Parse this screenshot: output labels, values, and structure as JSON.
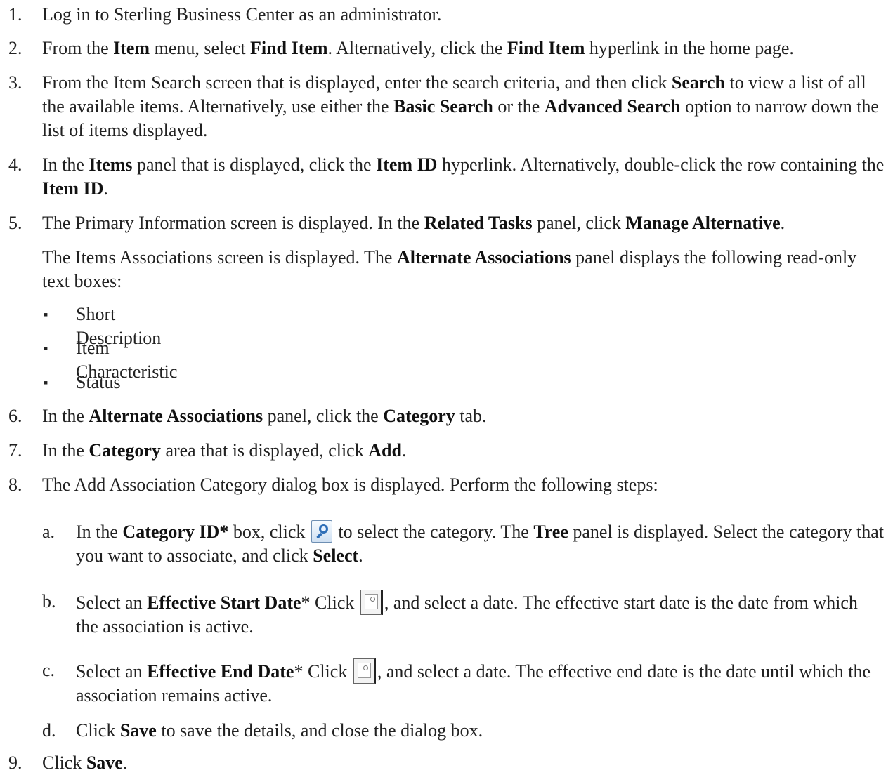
{
  "steps": [
    {
      "num": "1.",
      "html": "Log in to Sterling Business Center as an administrator."
    },
    {
      "num": "2.",
      "html": "From the <b>Item</b> menu, select <b>Find Item</b>. Alternatively, click the <b>Find Item</b> hyperlink in the home page."
    },
    {
      "num": "3.",
      "html": "From the Item Search screen that is displayed, enter the search criteria, and then click <b>Search</b> to view a list of all the available items. Alternatively, use either the <b>Basic Search</b> or the <b>Advanced Search</b> option to narrow down the list of items displayed."
    },
    {
      "num": "4.",
      "html": "In the <b>Items</b> panel that is displayed, click the <b>Item ID</b> hyperlink. Alternatively, double-click the row containing the <b>Item ID</b>."
    },
    {
      "num": "5.",
      "html": "The Primary Information screen is displayed. In the <b>Related Tasks</b> panel, click <b>Manage Alternative</b>."
    },
    {
      "num": "",
      "html": "The Items Associations screen is displayed. The <b>Alternate Associations</b> panel displays the following read-only text boxes:"
    },
    {
      "num": "6.",
      "html": "In the <b>Alternate Associations</b> panel, click the <b>Category</b> tab."
    },
    {
      "num": "7.",
      "html": "In the <b>Category</b> area that is displayed, click <b>Add</b>."
    },
    {
      "num": "8.",
      "html": "The Add Association Category dialog box is displayed. Perform the following steps:"
    },
    {
      "num": "9.",
      "html": "Click <b>Save</b>."
    }
  ],
  "bullets": [
    "Short Description",
    "Item Characteristic",
    "Status"
  ],
  "bullet_char": "▪",
  "substeps": [
    {
      "letter": "a.",
      "before": "In the <b>Category ID*</b> box, click ",
      "icon": "search-icon",
      "after": " to select the category. The <b>Tree</b> panel is displayed. Select the category that you want to associate, and click <b>Select</b>."
    },
    {
      "letter": "b.",
      "before": "Select an <b>Effective Start Date</b>* Click ",
      "icon": "calendar-icon",
      "after": ", and select a date. The effective start date is the date from which the association is active."
    },
    {
      "letter": "c.",
      "before": "Select an <b>Effective End Date</b>* Click ",
      "icon": "calendar-icon",
      "after": ", and select a date. The effective end date is the date until which the association remains active."
    },
    {
      "letter": "d.",
      "before": "Click <b>Save</b> to save the details, and close the dialog box.",
      "icon": "",
      "after": ""
    }
  ]
}
